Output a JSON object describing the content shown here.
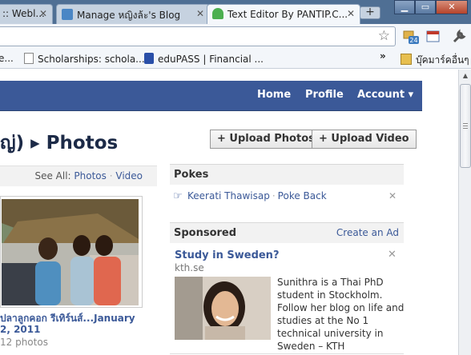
{
  "browser": {
    "tabs": [
      {
        "label": ":: Webl...",
        "active": false
      },
      {
        "label": "Manage หญิงล้ะ's Blog",
        "active": false
      },
      {
        "label": "Text Editor By PANTIP.C...",
        "active": true
      }
    ],
    "new_tab_label": "+",
    "window_controls": {
      "minimize": "▁",
      "maximize": "▭",
      "close": "✕"
    },
    "bookmarks": [
      {
        "label": "e..."
      },
      {
        "label": "Scholarships: schola..."
      },
      {
        "label": "eduPASS | Financial ..."
      }
    ],
    "bookmarks_overflow": "»",
    "other_bookmarks": "บุ๊คมาร์คอื่นๆ",
    "badge_count": "24"
  },
  "facebook": {
    "nav": {
      "home": "Home",
      "profile": "Profile",
      "account": "Account ▾"
    },
    "page_title": "ญ่) ▸ Photos",
    "upload_photos": "+ Upload Photos",
    "upload_video": "+ Upload Video",
    "see_all_label": "See All:",
    "see_all_photos": "Photos",
    "see_all_sep": "·",
    "see_all_video": "Video",
    "album": {
      "title": "ปลาลูกคอก รีเทิร์นส์...January",
      "date": "2, 2011",
      "count": "12 photos"
    },
    "pokes": {
      "heading": "Pokes",
      "name": "Keerati Thawisap",
      "sep": "·",
      "action": "Poke Back",
      "dismiss": "✕"
    },
    "sponsored": {
      "heading": "Sponsored",
      "create_ad": "Create an Ad",
      "ad_title": "Study in Sweden?",
      "ad_domain": "kth.se",
      "ad_text": "Sunithra is a Thai PhD student in Stockholm. Follow her blog on life and studies at the No 1 technical university in Sweden – KTH",
      "dismiss": "✕"
    }
  },
  "colors": {
    "fb_blue": "#3b5998",
    "link": "#3b5998",
    "tabstrip": "#4f6f94"
  }
}
